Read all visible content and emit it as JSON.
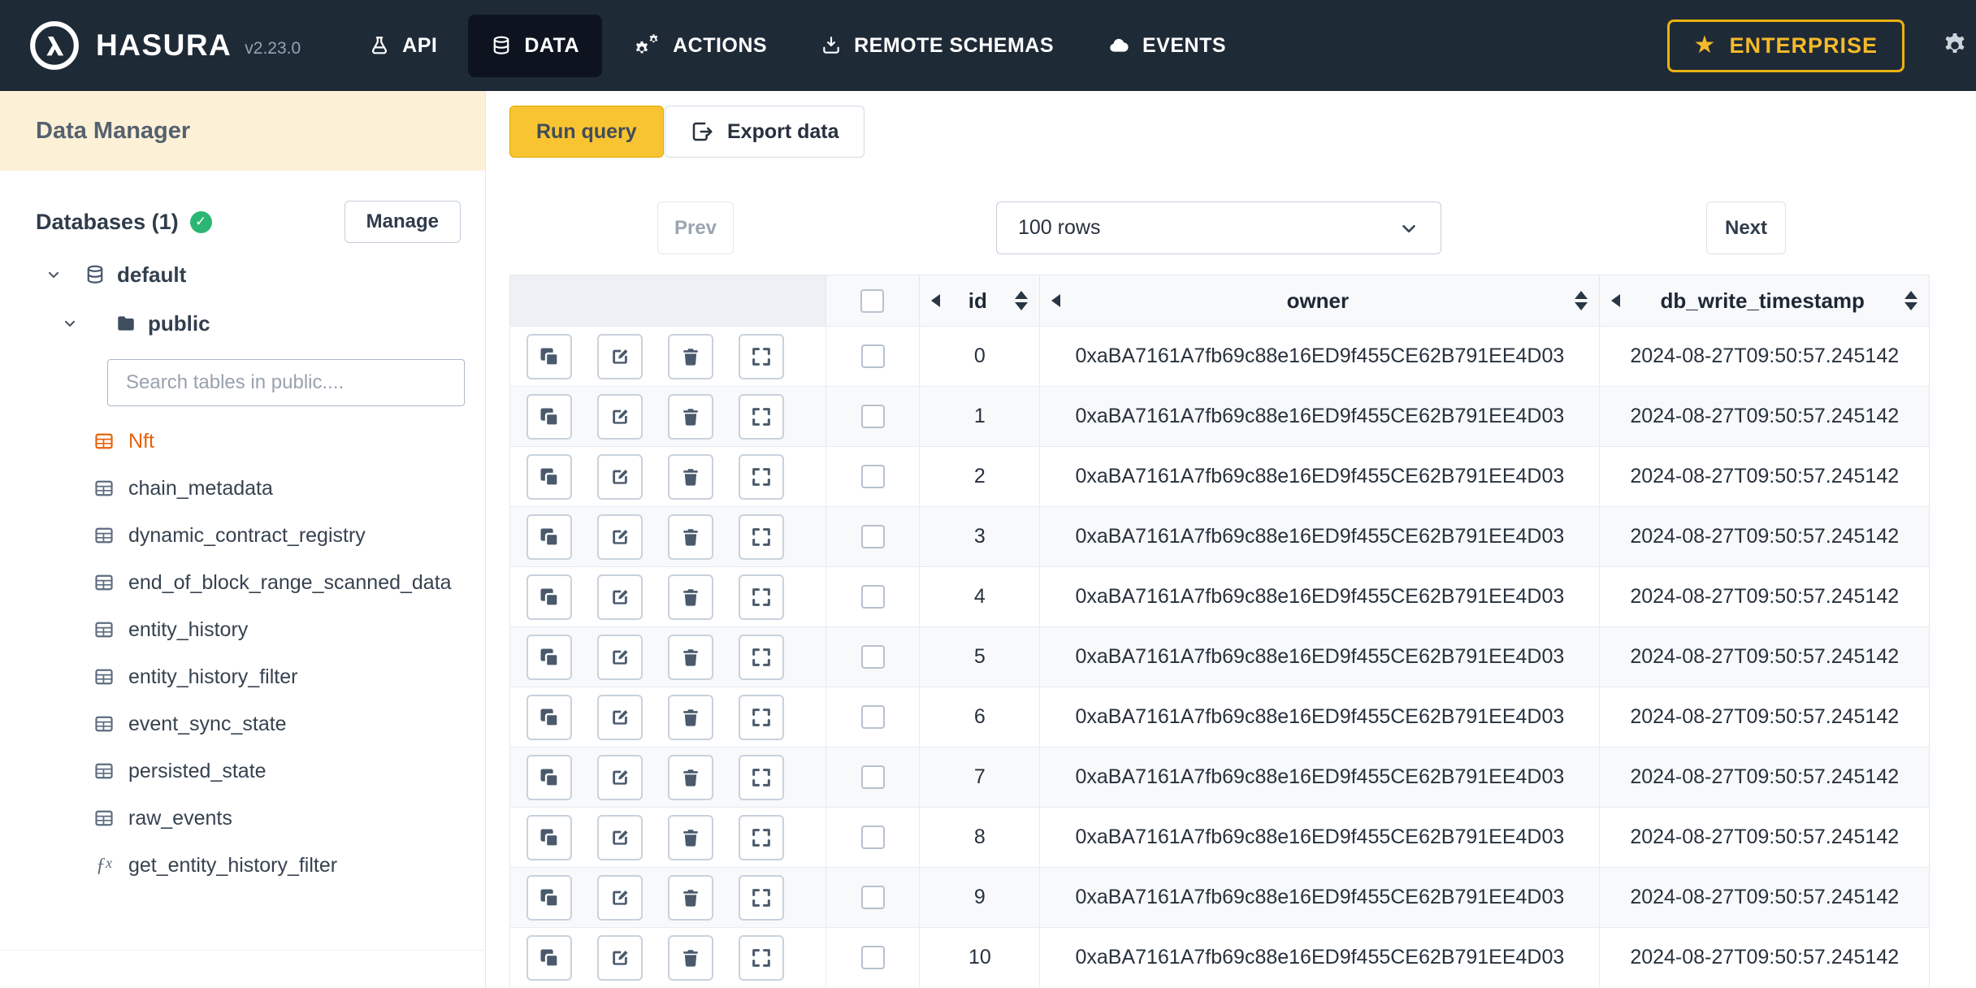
{
  "navbar": {
    "brand": "HASURA",
    "version": "v2.23.0",
    "items": [
      {
        "label": "API",
        "active": false
      },
      {
        "label": "DATA",
        "active": true
      },
      {
        "label": "ACTIONS",
        "active": false
      },
      {
        "label": "REMOTE SCHEMAS",
        "active": false
      },
      {
        "label": "EVENTS",
        "active": false
      }
    ],
    "enterprise_label": "ENTERPRISE"
  },
  "sidebar": {
    "title": "Data Manager",
    "databases_label": "Databases (1)",
    "manage_button": "Manage",
    "tree": {
      "database": "default",
      "schema": "public",
      "search_placeholder": "Search tables in public....",
      "tables": [
        {
          "name": "Nft",
          "type": "table",
          "active": true
        },
        {
          "name": "chain_metadata",
          "type": "table",
          "active": false
        },
        {
          "name": "dynamic_contract_registry",
          "type": "table",
          "active": false
        },
        {
          "name": "end_of_block_range_scanned_data",
          "type": "table",
          "active": false
        },
        {
          "name": "entity_history",
          "type": "table",
          "active": false
        },
        {
          "name": "entity_history_filter",
          "type": "table",
          "active": false
        },
        {
          "name": "event_sync_state",
          "type": "table",
          "active": false
        },
        {
          "name": "persisted_state",
          "type": "table",
          "active": false
        },
        {
          "name": "raw_events",
          "type": "table",
          "active": false
        },
        {
          "name": "get_entity_history_filter",
          "type": "function",
          "active": false
        }
      ]
    }
  },
  "toolbar": {
    "run_query": "Run query",
    "export_data": "Export data"
  },
  "pagination": {
    "prev": "Prev",
    "rows_label": "100 rows",
    "next": "Next"
  },
  "table": {
    "columns": [
      "id",
      "owner",
      "db_write_timestamp"
    ],
    "rows": [
      {
        "id": "0",
        "owner": "0xaBA7161A7fb69c88e16ED9f455CE62B791EE4D03",
        "db_write_timestamp": "2024-08-27T09:50:57.245142"
      },
      {
        "id": "1",
        "owner": "0xaBA7161A7fb69c88e16ED9f455CE62B791EE4D03",
        "db_write_timestamp": "2024-08-27T09:50:57.245142"
      },
      {
        "id": "2",
        "owner": "0xaBA7161A7fb69c88e16ED9f455CE62B791EE4D03",
        "db_write_timestamp": "2024-08-27T09:50:57.245142"
      },
      {
        "id": "3",
        "owner": "0xaBA7161A7fb69c88e16ED9f455CE62B791EE4D03",
        "db_write_timestamp": "2024-08-27T09:50:57.245142"
      },
      {
        "id": "4",
        "owner": "0xaBA7161A7fb69c88e16ED9f455CE62B791EE4D03",
        "db_write_timestamp": "2024-08-27T09:50:57.245142"
      },
      {
        "id": "5",
        "owner": "0xaBA7161A7fb69c88e16ED9f455CE62B791EE4D03",
        "db_write_timestamp": "2024-08-27T09:50:57.245142"
      },
      {
        "id": "6",
        "owner": "0xaBA7161A7fb69c88e16ED9f455CE62B791EE4D03",
        "db_write_timestamp": "2024-08-27T09:50:57.245142"
      },
      {
        "id": "7",
        "owner": "0xaBA7161A7fb69c88e16ED9f455CE62B791EE4D03",
        "db_write_timestamp": "2024-08-27T09:50:57.245142"
      },
      {
        "id": "8",
        "owner": "0xaBA7161A7fb69c88e16ED9f455CE62B791EE4D03",
        "db_write_timestamp": "2024-08-27T09:50:57.245142"
      },
      {
        "id": "9",
        "owner": "0xaBA7161A7fb69c88e16ED9f455CE62B791EE4D03",
        "db_write_timestamp": "2024-08-27T09:50:57.245142"
      },
      {
        "id": "10",
        "owner": "0xaBA7161A7fb69c88e16ED9f455CE62B791EE4D03",
        "db_write_timestamp": "2024-08-27T09:50:57.245142"
      }
    ]
  },
  "colors": {
    "navbar_bg": "#1f2a37",
    "navbar_active_bg": "#0d1420",
    "accent_yellow": "#f9c431",
    "enterprise_gold": "#eab211",
    "active_table_orange": "#e7630b",
    "success_green": "#2bb673",
    "sidebar_header_cream": "#fcf0d6"
  }
}
